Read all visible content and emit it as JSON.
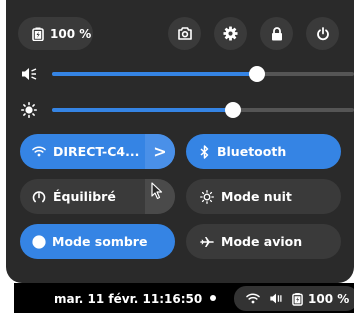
{
  "quick_settings": {
    "battery_label": "100 %",
    "icons": {
      "battery": "battery-icon",
      "screenshot": "camera-icon",
      "settings": "gear-icon",
      "lock": "lock-icon",
      "power": "power-icon"
    },
    "volume": {
      "icon": "speaker-muted-icon",
      "level": 0.68
    },
    "brightness": {
      "icon": "sun-icon",
      "level": 0.6
    },
    "toggles": [
      {
        "id": "wifi",
        "label": "DIRECT-C4...",
        "icon": "wifi-icon",
        "active": true,
        "has_menu": true,
        "menu_glyph": ">"
      },
      {
        "id": "bluetooth",
        "label": "Bluetooth",
        "icon": "bluetooth-icon",
        "active": true,
        "has_menu": false
      },
      {
        "id": "power-mode",
        "label": "Équilibré",
        "icon": "gauge-icon",
        "active": false,
        "has_menu": true,
        "menu_glyph": ">"
      },
      {
        "id": "night-mode",
        "label": "Mode nuit",
        "icon": "night-light-icon",
        "active": false,
        "has_menu": false
      },
      {
        "id": "dark-mode",
        "label": "Mode sombre",
        "icon": "dark-mode-icon",
        "active": true,
        "has_menu": false
      },
      {
        "id": "airplane",
        "label": "Mode avion",
        "icon": "airplane-icon",
        "active": false,
        "has_menu": false
      }
    ]
  },
  "topbar": {
    "clock": "mar. 11 févr.  11:16:50",
    "battery_label": "100 %"
  },
  "colors": {
    "accent": "#3584e4",
    "panel_bg": "#2a2a2a",
    "tile_bg": "#3a3a3a"
  }
}
